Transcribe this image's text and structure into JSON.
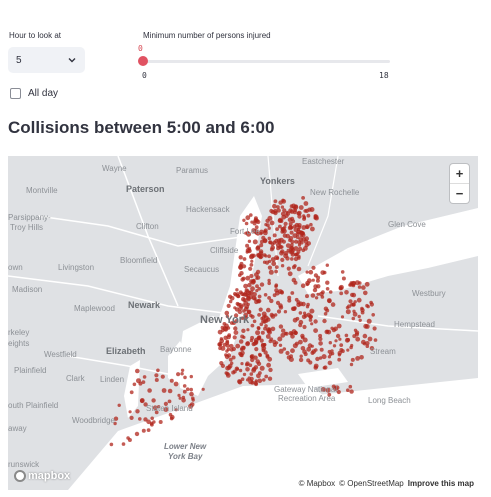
{
  "controls": {
    "hour_label": "Hour to look at",
    "hour_value": "5",
    "injured_label": "Minimum number of persons injured",
    "injured_current": "0",
    "injured_min": "0",
    "injured_max": "18",
    "injured_value_fraction": 0,
    "all_day_label": "All day",
    "all_day_checked": false
  },
  "heading": {
    "title": "Collisions between 5:00 and 6:00"
  },
  "map": {
    "places": {
      "wayne": "Wayne",
      "paramus": "Paramus",
      "eastchester": "Eastchester",
      "montville": "Montville",
      "paterson": "Paterson",
      "yonkers": "Yonkers",
      "new_rochelle": "New Rochelle",
      "parsippany": "Parsippany-",
      "troy_hills": "Troy Hills",
      "clifton": "Clifton",
      "hackensack": "Hackensack",
      "glen_cove": "Glen Cove",
      "fort_lee": "Fort Lee",
      "cliffside": "Cliffside",
      "livingston": "Livingston",
      "bloomfield": "Bloomfield",
      "secaucus": "Secaucus",
      "town": "own",
      "madison": "Madison",
      "westbury": "Westbury",
      "maplewood": "Maplewood",
      "newark": "Newark",
      "new_york": "New York",
      "hempstead": "Hempstead",
      "rkeley": "rkeley",
      "eights": "eights",
      "westfield": "Westfield",
      "elizabeth": "Elizabeth",
      "bayonne": "Bayonne",
      "stream": "Stream",
      "plainfield": "Plainfield",
      "clark": "Clark",
      "linden": "Linden",
      "south_plainfield": "outh Plainfield",
      "staten_island": "Staten Island",
      "gateway": "Gateway National",
      "recreation": "Recreation Area",
      "long_beach": "Long Beach",
      "woodbridge": "Woodbridge",
      "away": "away",
      "lower_ny_bay_1": "Lower New",
      "lower_ny_bay_2": "York Bay",
      "brunswick": "runswick"
    },
    "zoom_in": "+",
    "zoom_out": "−",
    "logo_text": "mapbox",
    "attribution_mapbox": "© Mapbox",
    "attribution_osm": "© OpenStreetMap",
    "improve_link": "Improve this map",
    "point_color": "#b0261c"
  }
}
